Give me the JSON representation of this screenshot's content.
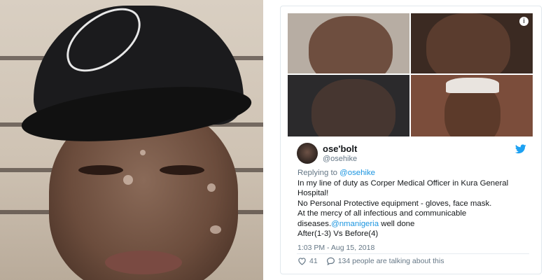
{
  "tweet": {
    "display_name": "ose'bolt",
    "handle": "@osehike",
    "replying_label": "Replying to",
    "replying_to": "@osehike",
    "text_line_1": "In my line of duty as Corper Medical Officer in Kura General Hospital!",
    "text_line_2": "No Personal Protective equipment - gloves, face mask.",
    "text_line_3_pre": "At the mercy of all infectious  and communicable diseases.",
    "text_line_3_mention": "@nmanigeria",
    "text_line_3_post": " well done",
    "text_line_4": "After(1-3) Vs Before(4)",
    "timestamp": "1:03 PM - Aug 15, 2018",
    "likes": "41",
    "talking_about": "134 people are talking about this",
    "info_glyph": "i"
  },
  "icons": {
    "bird": "twitter-bird-icon",
    "heart": "heart-icon",
    "comment": "comment-icon",
    "info": "info-icon"
  },
  "colors": {
    "link": "#1b95e0",
    "muted": "#657786",
    "text": "#14171a",
    "border": "#e1e8ed"
  }
}
